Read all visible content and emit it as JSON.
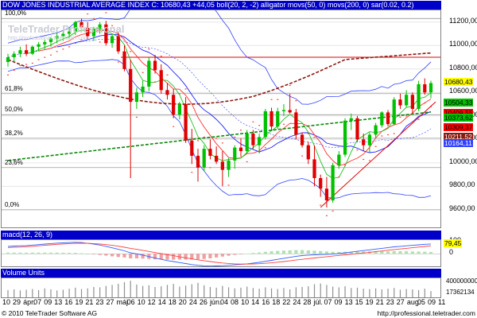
{
  "header": {
    "main": "DOW JONES INDUSTRIAL AVERAGE INDEX C: 10680,43 +44,05 boll(20, 2, -2) alligator movs(50, 0) movs(200, 0) sar(0.02, 0.2)",
    "macd": "macd(12, 26, 9)",
    "volume": "Volume Units"
  },
  "watermark": {
    "title": "TeleTrader Professional",
    "url": "http://professional.teletrader.com"
  },
  "colors": {
    "header_bg": "#0000c8",
    "up": "#00c000",
    "down": "#e00000",
    "boll": "#3040ff",
    "ma50": "#8b1a10",
    "ma200": "#0a8a0a",
    "sar": "#ff4040",
    "jaw": "#2020ff",
    "teeth": "#ff3030",
    "lips": "#20c020",
    "resistance": "#e00000",
    "support": "#00a000"
  },
  "chart_data": [
    {
      "type": "candlestick",
      "title": "DOW JONES INDUSTRIAL AVERAGE INDEX C",
      "last": "10680,43",
      "change": "+44,05",
      "ylim": [
        9450,
        11300
      ],
      "yticks": [
        "11200,00",
        "11000,00",
        "10800,00",
        "10600,00",
        "10400,00",
        "10200,00",
        "10000,00",
        "9800,00",
        "9600,00"
      ],
      "ytick_values": [
        11200,
        11000,
        10800,
        10600,
        10400,
        10200,
        10000,
        9800,
        9600
      ],
      "x": [
        "10",
        "29",
        "ápr.",
        "07",
        "09",
        "13",
        "16",
        "19",
        "21",
        "23",
        "27",
        "máj.",
        "06",
        "10",
        "12",
        "14",
        "18",
        "20",
        "24",
        "26",
        "jún.",
        "04",
        "08",
        "10",
        "14",
        "16",
        "18",
        "22",
        "24",
        "28",
        "júl.",
        "07",
        "09",
        "13",
        "15",
        "19",
        "21",
        "23",
        "27",
        "aug.",
        "05",
        "09",
        "11"
      ],
      "fib_levels": [
        {
          "label": "100,0%",
          "value": 11230
        },
        {
          "label": "61,8%",
          "value": 10590
        },
        {
          "label": "50,0%",
          "value": 10410
        },
        {
          "label": "38,2%",
          "value": 10210
        },
        {
          "label": "23,6%",
          "value": 9960
        },
        {
          "label": "0,0%",
          "value": 9600
        }
      ],
      "price_tags": [
        {
          "text": "10680,43",
          "value": 10680,
          "bg": "#ffff00",
          "fg": "#000"
        },
        {
          "text": "10504,33",
          "value": 10504,
          "bg": "#00c000",
          "fg": "#000"
        },
        {
          "text": "10409,55",
          "value": 10420,
          "bg": "#ff0000",
          "fg": "#000"
        },
        {
          "text": "10373,62",
          "value": 10380,
          "bg": "#00c000",
          "fg": "#000"
        },
        {
          "text": "10309,37",
          "value": 10300,
          "bg": "#ff0000",
          "fg": "#000"
        },
        {
          "text": "10211,52",
          "value": 10214,
          "bg": "#8b1a10",
          "fg": "#fff"
        },
        {
          "text": "10164,11",
          "value": 10160,
          "bg": "#3040ff",
          "fg": "#fff"
        }
      ],
      "resistance": 10900,
      "candles": [
        [
          10860,
          10930,
          10820,
          10900
        ],
        [
          10900,
          10950,
          10860,
          10930
        ],
        [
          10930,
          10990,
          10900,
          10960
        ],
        [
          10960,
          11010,
          10910,
          10930
        ],
        [
          10930,
          11000,
          10920,
          10990
        ],
        [
          10990,
          11030,
          10950,
          11010
        ],
        [
          11010,
          11050,
          10970,
          11030
        ],
        [
          11030,
          11070,
          10990,
          11060
        ],
        [
          11060,
          11110,
          11020,
          11080
        ],
        [
          11080,
          11130,
          11040,
          11100
        ],
        [
          11100,
          11150,
          11060,
          11120
        ],
        [
          11120,
          11210,
          11090,
          11200
        ],
        [
          11200,
          11230,
          11120,
          11150
        ],
        [
          11150,
          11200,
          11050,
          11080
        ],
        [
          11080,
          11160,
          11040,
          11140
        ],
        [
          11140,
          11200,
          11100,
          11180
        ],
        [
          11180,
          11210,
          11000,
          11020
        ],
        [
          11020,
          11100,
          10980,
          11080
        ],
        [
          11080,
          11120,
          10930,
          10950
        ],
        [
          10950,
          11000,
          10780,
          10800
        ],
        [
          10800,
          10880,
          9870,
          10520
        ],
        [
          10520,
          10640,
          10460,
          10600
        ],
        [
          10600,
          10700,
          10560,
          10650
        ],
        [
          10650,
          10900,
          10610,
          10870
        ],
        [
          10870,
          10920,
          10760,
          10790
        ],
        [
          10790,
          10840,
          10590,
          10620
        ],
        [
          10620,
          10680,
          10540,
          10580
        ],
        [
          10580,
          10630,
          10380,
          10410
        ],
        [
          10410,
          10520,
          10370,
          10500
        ],
        [
          10500,
          10560,
          10170,
          10190
        ],
        [
          10190,
          10290,
          9990,
          10060
        ],
        [
          10060,
          10120,
          9840,
          9960
        ],
        [
          9960,
          10150,
          9930,
          10120
        ],
        [
          10120,
          10200,
          10030,
          10060
        ],
        [
          10060,
          10140,
          9990,
          10010
        ],
        [
          10010,
          10100,
          9800,
          9940
        ],
        [
          9940,
          10040,
          9880,
          10020
        ],
        [
          10020,
          10150,
          9950,
          10130
        ],
        [
          10130,
          10210,
          10050,
          10100
        ],
        [
          10100,
          10280,
          10080,
          10250
        ],
        [
          10250,
          10280,
          10120,
          10150
        ],
        [
          10150,
          10250,
          10080,
          10220
        ],
        [
          10220,
          10460,
          10200,
          10440
        ],
        [
          10440,
          10470,
          10280,
          10310
        ],
        [
          10310,
          10470,
          10290,
          10440
        ],
        [
          10440,
          10500,
          10400,
          10450
        ],
        [
          10450,
          10590,
          10420,
          10430
        ],
        [
          10430,
          10460,
          10200,
          10240
        ],
        [
          10240,
          10260,
          10130,
          10150
        ],
        [
          10150,
          10180,
          9990,
          10030
        ],
        [
          10030,
          10150,
          9800,
          9870
        ],
        [
          9870,
          9900,
          9710,
          9780
        ],
        [
          9780,
          9880,
          9620,
          9680
        ],
        [
          9680,
          10000,
          9660,
          9980
        ],
        [
          9980,
          10100,
          9950,
          10070
        ],
        [
          10070,
          10380,
          10050,
          10360
        ],
        [
          10360,
          10420,
          10280,
          10380
        ],
        [
          10380,
          10400,
          10180,
          10200
        ],
        [
          10200,
          10250,
          10100,
          10150
        ],
        [
          10150,
          10260,
          10090,
          10240
        ],
        [
          10240,
          10340,
          10210,
          10320
        ],
        [
          10320,
          10440,
          10300,
          10430
        ],
        [
          10430,
          10450,
          10310,
          10330
        ],
        [
          10330,
          10560,
          10320,
          10540
        ],
        [
          10540,
          10590,
          10460,
          10490
        ],
        [
          10490,
          10620,
          10470,
          10580
        ],
        [
          10580,
          10600,
          10420,
          10460
        ],
        [
          10460,
          10700,
          10440,
          10670
        ],
        [
          10670,
          10720,
          10580,
          10600
        ],
        [
          10600,
          10700,
          10550,
          10680
        ]
      ]
    },
    {
      "type": "line",
      "title": "macd(12, 26, 9)",
      "ylim": [
        -100,
        110
      ],
      "yticks": [
        "100",
        "0"
      ],
      "ytick_values": [
        100,
        0
      ],
      "last_value": "79,45",
      "series": [
        {
          "name": "macd",
          "values": [
            60,
            62,
            64,
            66,
            70,
            74,
            78,
            82,
            86,
            88,
            90,
            92,
            90,
            84,
            78,
            70,
            60,
            48,
            36,
            24,
            8,
            0,
            -10,
            -22,
            -34,
            -44,
            -54,
            -62,
            -70,
            -78,
            -86,
            -92,
            -96,
            -98,
            -97,
            -95,
            -92,
            -88,
            -84,
            -80,
            -74,
            -68,
            -60,
            -52,
            -44,
            -36,
            -28,
            -20,
            -14,
            -10,
            -8,
            -6,
            -4,
            -2,
            2,
            8,
            14,
            20,
            26,
            32,
            38,
            44,
            50,
            56,
            60,
            64,
            68,
            72,
            76,
            79
          ]
        },
        {
          "name": "signal",
          "values": [
            50,
            52,
            54,
            57,
            60,
            64,
            68,
            72,
            76,
            79,
            82,
            84,
            85,
            84,
            82,
            79,
            74,
            68,
            61,
            53,
            44,
            36,
            28,
            19,
            10,
            2,
            -7,
            -15,
            -24,
            -32,
            -40,
            -48,
            -55,
            -62,
            -68,
            -73,
            -77,
            -80,
            -82,
            -82,
            -81,
            -79,
            -76,
            -72,
            -67,
            -62,
            -56,
            -50,
            -44,
            -38,
            -33,
            -28,
            -23,
            -18,
            -13,
            -8,
            -3,
            2,
            7,
            12,
            18,
            23,
            29,
            34,
            39,
            44,
            49,
            54,
            59,
            64
          ]
        }
      ]
    },
    {
      "type": "bar",
      "title": "Volume Units",
      "ylim": [
        0,
        5000000000
      ],
      "yticks": [
        "400000000",
        "17362134"
      ],
      "ytick_values": [
        4000000000,
        1736213400
      ],
      "values": [
        2.1,
        2.3,
        2.0,
        2.2,
        2.4,
        2.1,
        2.6,
        2.3,
        2.0,
        2.2,
        2.5,
        2.8,
        2.4,
        2.6,
        3.0,
        2.9,
        3.3,
        3.6,
        3.9,
        4.4,
        4.8,
        3.7,
        3.3,
        3.5,
        3.0,
        3.2,
        3.6,
        3.9,
        3.1,
        3.4,
        3.8,
        4.2,
        3.5,
        3.0,
        2.8,
        3.3,
        2.9,
        2.6,
        2.8,
        3.1,
        2.7,
        2.5,
        2.9,
        2.6,
        2.4,
        2.7,
        2.3,
        2.9,
        3.0,
        3.2,
        3.8,
        4.0,
        3.6,
        3.1,
        2.9,
        3.2,
        2.7,
        2.8,
        2.5,
        2.4,
        2.6,
        2.3,
        2.5,
        2.7,
        2.2,
        2.4,
        2.3,
        2.1,
        2.5,
        1.8
      ]
    }
  ],
  "xaxis_labels_geometry_note": "",
  "footer": {
    "left": "© 2010 TeleTrader Software AG",
    "right": "http://professional.teletrader.com"
  }
}
